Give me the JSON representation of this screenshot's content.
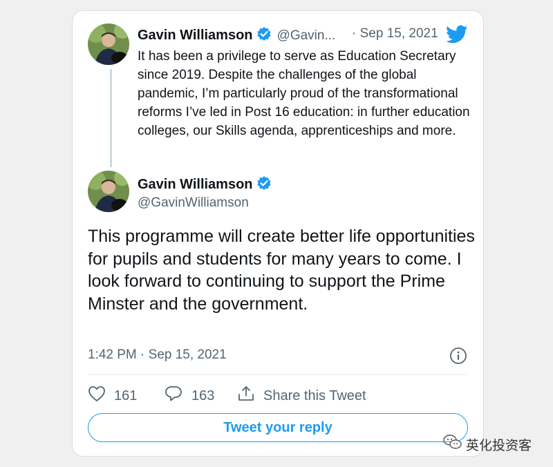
{
  "quoted_tweet": {
    "author_name": "Gavin Williamson",
    "handle": "@Gavin...",
    "date": "· Sep 15, 2021",
    "text": "It has been a privilege to serve as Education Secretary since 2019. Despite the challenges of the global pandemic, I’m particularly proud of the transformational reforms I’ve led in Post 16 education: in further education colleges, our Skills agenda, apprenticeships and more."
  },
  "main_tweet": {
    "author_name": "Gavin Williamson",
    "handle": "@GavinWilliamson",
    "text": "This programme will create better life opportunities for pupils and students for many years to come. I look forward to continuing to support the Prime Minster and the government.",
    "timestamp": "1:42 PM · Sep 15, 2021"
  },
  "actions": {
    "likes": "161",
    "replies": "163",
    "share_label": "Share this Tweet"
  },
  "reply_button": "Tweet your reply",
  "watermark": "英化投资客",
  "colors": {
    "twitter_blue": "#1d9bf0",
    "secondary_text": "#536471",
    "primary_text": "#0f1419"
  },
  "icons": {
    "brand": "twitter-bird-icon",
    "verified": "verified-badge-icon",
    "info": "info-icon",
    "like": "heart-icon",
    "reply": "speech-bubble-icon",
    "share": "share-icon"
  }
}
